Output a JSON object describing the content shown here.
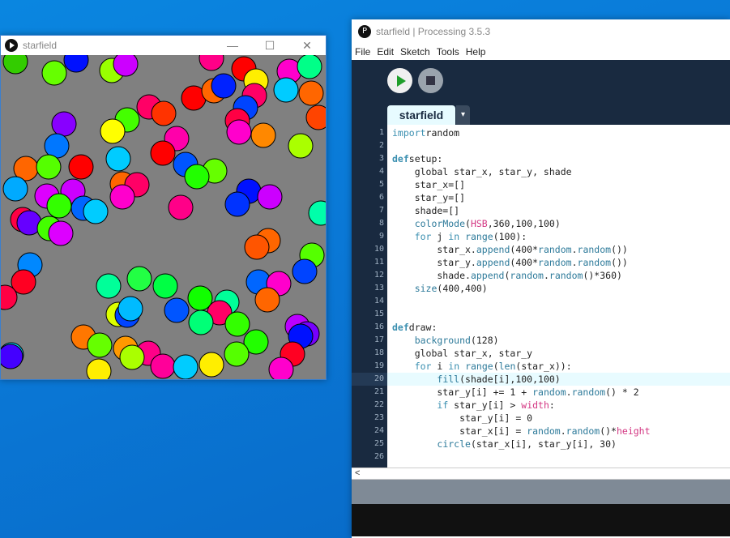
{
  "sketch_window": {
    "title": "starfield",
    "min": "—",
    "max": "☐",
    "close": "✕"
  },
  "pde": {
    "title": "starfield | Processing 3.5.3",
    "logo": "P"
  },
  "menu": [
    "File",
    "Edit",
    "Sketch",
    "Tools",
    "Help"
  ],
  "tab": {
    "label": "starfield",
    "dropdown": "▾"
  },
  "hscroll_arrow": "<",
  "circles": [
    [
      18,
      76,
      "#33cc00"
    ],
    [
      93,
      74,
      "#0011ff"
    ],
    [
      137,
      87,
      "#99ff00"
    ],
    [
      154,
      79,
      "#cc00ff"
    ],
    [
      260,
      72,
      "#ff0088"
    ],
    [
      300,
      85,
      "#ff0000"
    ],
    [
      315,
      100,
      "#ffee00"
    ],
    [
      356,
      88,
      "#ff00cc"
    ],
    [
      381,
      82,
      "#00ff88"
    ],
    [
      66,
      90,
      "#66ff00"
    ],
    [
      352,
      111,
      "#00ccff"
    ],
    [
      383,
      115,
      "#ff6600"
    ],
    [
      238,
      121,
      "#ff0000"
    ],
    [
      263,
      112,
      "#ff6600"
    ],
    [
      275,
      106,
      "#0022ff"
    ],
    [
      313,
      118,
      "#ff0066"
    ],
    [
      302,
      133,
      "#0044ff"
    ],
    [
      183,
      132,
      "#ff0066"
    ],
    [
      201,
      140,
      "#ff3300"
    ],
    [
      156,
      148,
      "#44ff00"
    ],
    [
      138,
      162,
      "#ffff00"
    ],
    [
      78,
      153,
      "#8800ff"
    ],
    [
      292,
      149,
      "#ff0044"
    ],
    [
      294,
      163,
      "#ff00cc"
    ],
    [
      324,
      167,
      "#ff8800"
    ],
    [
      392,
      145,
      "#ff4400"
    ],
    [
      370,
      180,
      "#aaff00"
    ],
    [
      217,
      171,
      "#ff00aa"
    ],
    [
      69,
      180,
      "#0077ff"
    ],
    [
      145,
      196,
      "#00ccff"
    ],
    [
      200,
      189,
      "#ff0000"
    ],
    [
      228,
      203,
      "#0055ff"
    ],
    [
      31,
      208,
      "#ff6600"
    ],
    [
      59,
      206,
      "#55ff00"
    ],
    [
      99,
      206,
      "#ff0000"
    ],
    [
      264,
      211,
      "#66ff00"
    ],
    [
      242,
      218,
      "#22ff00"
    ],
    [
      150,
      227,
      "#ff6600"
    ],
    [
      168,
      228,
      "#ff0066"
    ],
    [
      18,
      233,
      "#00aaff"
    ],
    [
      89,
      236,
      "#cc00ff"
    ],
    [
      150,
      243,
      "#ff00cc"
    ],
    [
      57,
      242,
      "#dd00ff"
    ],
    [
      306,
      236,
      "#0011ff"
    ],
    [
      332,
      243,
      "#cc00ff"
    ],
    [
      292,
      252,
      "#0033ff"
    ],
    [
      222,
      256,
      "#ff0088"
    ],
    [
      102,
      257,
      "#0066ff"
    ],
    [
      117,
      261,
      "#00ccff"
    ],
    [
      72,
      254,
      "#33ff00"
    ],
    [
      395,
      263,
      "#00ffaa"
    ],
    [
      27,
      271,
      "#ff0044"
    ],
    [
      35,
      275,
      "#6600ff"
    ],
    [
      60,
      282,
      "#44ff00"
    ],
    [
      74,
      288,
      "#dd00ff"
    ],
    [
      330,
      297,
      "#ff6600"
    ],
    [
      316,
      305,
      "#ff5500"
    ],
    [
      384,
      315,
      "#55ff00"
    ],
    [
      36,
      327,
      "#0088ff"
    ],
    [
      375,
      335,
      "#0044ff"
    ],
    [
      28,
      348,
      "#ff0022"
    ],
    [
      133,
      353,
      "#00ff99"
    ],
    [
      171,
      344,
      "#22ff44"
    ],
    [
      203,
      353,
      "#00ff44"
    ],
    [
      318,
      348,
      "#0066ff"
    ],
    [
      343,
      350,
      "#ff00cc"
    ],
    [
      329,
      370,
      "#ff6600"
    ],
    [
      246,
      368,
      "#11ff00"
    ],
    [
      279,
      373,
      "#00ff99"
    ],
    [
      270,
      386,
      "#ff0066"
    ],
    [
      145,
      388,
      "#ddff00"
    ],
    [
      156,
      389,
      "#0044ff"
    ],
    [
      160,
      381,
      "#00bbff"
    ],
    [
      217,
      383,
      "#0055ff"
    ],
    [
      5,
      367,
      "#ff0044"
    ],
    [
      247,
      398,
      "#00ff77"
    ],
    [
      292,
      400,
      "#33ff00"
    ],
    [
      102,
      416,
      "#ff7700"
    ],
    [
      366,
      403,
      "#bb00ff"
    ],
    [
      378,
      412,
      "#7700ff"
    ],
    [
      370,
      415,
      "#0011ff"
    ],
    [
      315,
      422,
      "#22ff00"
    ],
    [
      122,
      426,
      "#66ff00"
    ],
    [
      154,
      430,
      "#ff9900"
    ],
    [
      182,
      436,
      "#ff0088"
    ],
    [
      162,
      441,
      "#aaff00"
    ],
    [
      360,
      437,
      "#ff0022"
    ],
    [
      291,
      437,
      "#55ff00"
    ],
    [
      13,
      438,
      "#00ddff"
    ],
    [
      12,
      440,
      "#4400ff"
    ],
    [
      200,
      452,
      "#ff0099"
    ],
    [
      228,
      453,
      "#00ccff"
    ],
    [
      260,
      450,
      "#ffee00"
    ],
    [
      346,
      456,
      "#ff00cc"
    ],
    [
      121,
      458,
      "#ffee00"
    ]
  ],
  "code": [
    [
      [
        "kw",
        "import"
      ],
      [
        "",
        "random"
      ]
    ],
    [],
    [
      [
        "def",
        "def"
      ],
      [
        "",
        "setup"
      ],
      [
        "",
        ":"
      ]
    ],
    [
      [
        "",
        "    global star_x, star_y, shade"
      ]
    ],
    [
      [
        "",
        "    star_x=[]"
      ]
    ],
    [
      [
        "",
        "    star_y=[]"
      ]
    ],
    [
      [
        "",
        "    shade=[]"
      ]
    ],
    [
      [
        "",
        "    "
      ],
      [
        "fn",
        "colorMode"
      ],
      [
        "",
        "("
      ],
      [
        "cn",
        "HSB"
      ],
      [
        "",
        ",360,100,100)"
      ]
    ],
    [
      [
        "",
        "    "
      ],
      [
        "kw",
        "for"
      ],
      [
        "",
        " j "
      ],
      [
        "kw",
        "in"
      ],
      [
        "",
        " "
      ],
      [
        "fn",
        "range"
      ],
      [
        "",
        "(100):"
      ]
    ],
    [
      [
        "",
        "        star_x."
      ],
      [
        "fn",
        "append"
      ],
      [
        "",
        "(400*"
      ],
      [
        "fn",
        "random"
      ],
      [
        "",
        "."
      ],
      [
        "fn",
        "random"
      ],
      [
        "",
        "())"
      ]
    ],
    [
      [
        "",
        "        star_y."
      ],
      [
        "fn",
        "append"
      ],
      [
        "",
        "(400*"
      ],
      [
        "fn",
        "random"
      ],
      [
        "",
        "."
      ],
      [
        "fn",
        "random"
      ],
      [
        "",
        "())"
      ]
    ],
    [
      [
        "",
        "        shade."
      ],
      [
        "fn",
        "append"
      ],
      [
        "",
        "("
      ],
      [
        "fn",
        "random"
      ],
      [
        "",
        "."
      ],
      [
        "fn",
        "random"
      ],
      [
        "",
        "()*360)"
      ]
    ],
    [
      [
        "",
        "    "
      ],
      [
        "fn",
        "size"
      ],
      [
        "",
        "(400,400)"
      ]
    ],
    [],
    [],
    [
      [
        "def",
        "def"
      ],
      [
        "",
        "draw"
      ],
      [
        "",
        ":"
      ]
    ],
    [
      [
        "",
        "    "
      ],
      [
        "fn",
        "background"
      ],
      [
        "",
        "(128)"
      ]
    ],
    [
      [
        "",
        "    global star_x, star_y"
      ]
    ],
    [
      [
        "",
        "    "
      ],
      [
        "kw",
        "for"
      ],
      [
        "",
        " i "
      ],
      [
        "kw",
        "in"
      ],
      [
        "",
        " "
      ],
      [
        "fn",
        "range"
      ],
      [
        "",
        "("
      ],
      [
        "fn",
        "len"
      ],
      [
        "",
        "(star_x)):"
      ]
    ],
    [
      [
        "",
        "        "
      ],
      [
        "fn",
        "fill"
      ],
      [
        "",
        "(shade[i],100,100)"
      ]
    ],
    [
      [
        "",
        "        star_y[i] += 1 + "
      ],
      [
        "fn",
        "random"
      ],
      [
        "",
        "."
      ],
      [
        "fn",
        "random"
      ],
      [
        "",
        "() * 2"
      ]
    ],
    [
      [
        "",
        "        "
      ],
      [
        "kw",
        "if"
      ],
      [
        "",
        " star_y[i] > "
      ],
      [
        "cn",
        "width"
      ],
      [
        "",
        ":"
      ]
    ],
    [
      [
        "",
        "            star_y[i] = 0"
      ]
    ],
    [
      [
        "",
        "            star_x[i] = "
      ],
      [
        "fn",
        "random"
      ],
      [
        "",
        "."
      ],
      [
        "fn",
        "random"
      ],
      [
        "",
        "()*"
      ],
      [
        "cn",
        "height"
      ]
    ],
    [
      [
        "",
        "        "
      ],
      [
        "fn",
        "circle"
      ],
      [
        "",
        "(star_x[i], star_y[i], 30)"
      ]
    ],
    []
  ],
  "highlight_line": 20
}
